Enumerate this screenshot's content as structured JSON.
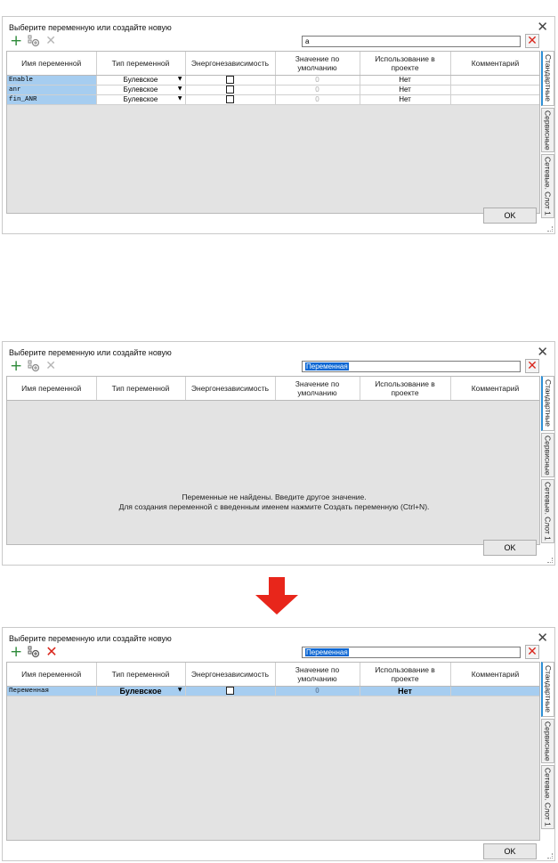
{
  "dialog_title": "Выберите переменную или создайте новую",
  "ok_label": "OK",
  "columns": [
    "Имя переменной",
    "Тип переменной",
    "Энергонезависимость",
    "Значение по умолчанию",
    "Использование в проекте",
    "Комментарий"
  ],
  "side_tabs": [
    "Стандартные",
    "Сервисные",
    "Сетевые. Слот 1"
  ],
  "panel1": {
    "search_value": "a",
    "rows": [
      {
        "name": "Enable",
        "type": "Булевское",
        "default": "0",
        "usage": "Нет",
        "comment": ""
      },
      {
        "name": "anr",
        "type": "Булевское",
        "default": "0",
        "usage": "Нет",
        "comment": ""
      },
      {
        "name": "fin_ANR",
        "type": "Булевское",
        "default": "0",
        "usage": "Нет",
        "comment": ""
      }
    ]
  },
  "panel2": {
    "search_value": "Переменная",
    "empty_line1": "Переменные не найдены. Введите другое значение.",
    "empty_line2": "Для создания переменной с введенным именем нажмите Создать переменную (Ctrl+N)."
  },
  "panel3": {
    "search_value": "Переменная",
    "rows": [
      {
        "name": "Переменная",
        "type": "Булевское",
        "default": "0",
        "usage": "Нет",
        "comment": ""
      }
    ]
  },
  "colors": {
    "accent_red": "#d9261c",
    "selection_blue": "#a6cdf0",
    "add_green": "#2e8b3a"
  },
  "icons": [
    "add-icon",
    "add-global-icon",
    "delete-icon",
    "close-icon",
    "clear-search-icon",
    "dropdown-arrow-icon",
    "down-arrow-icon"
  ]
}
